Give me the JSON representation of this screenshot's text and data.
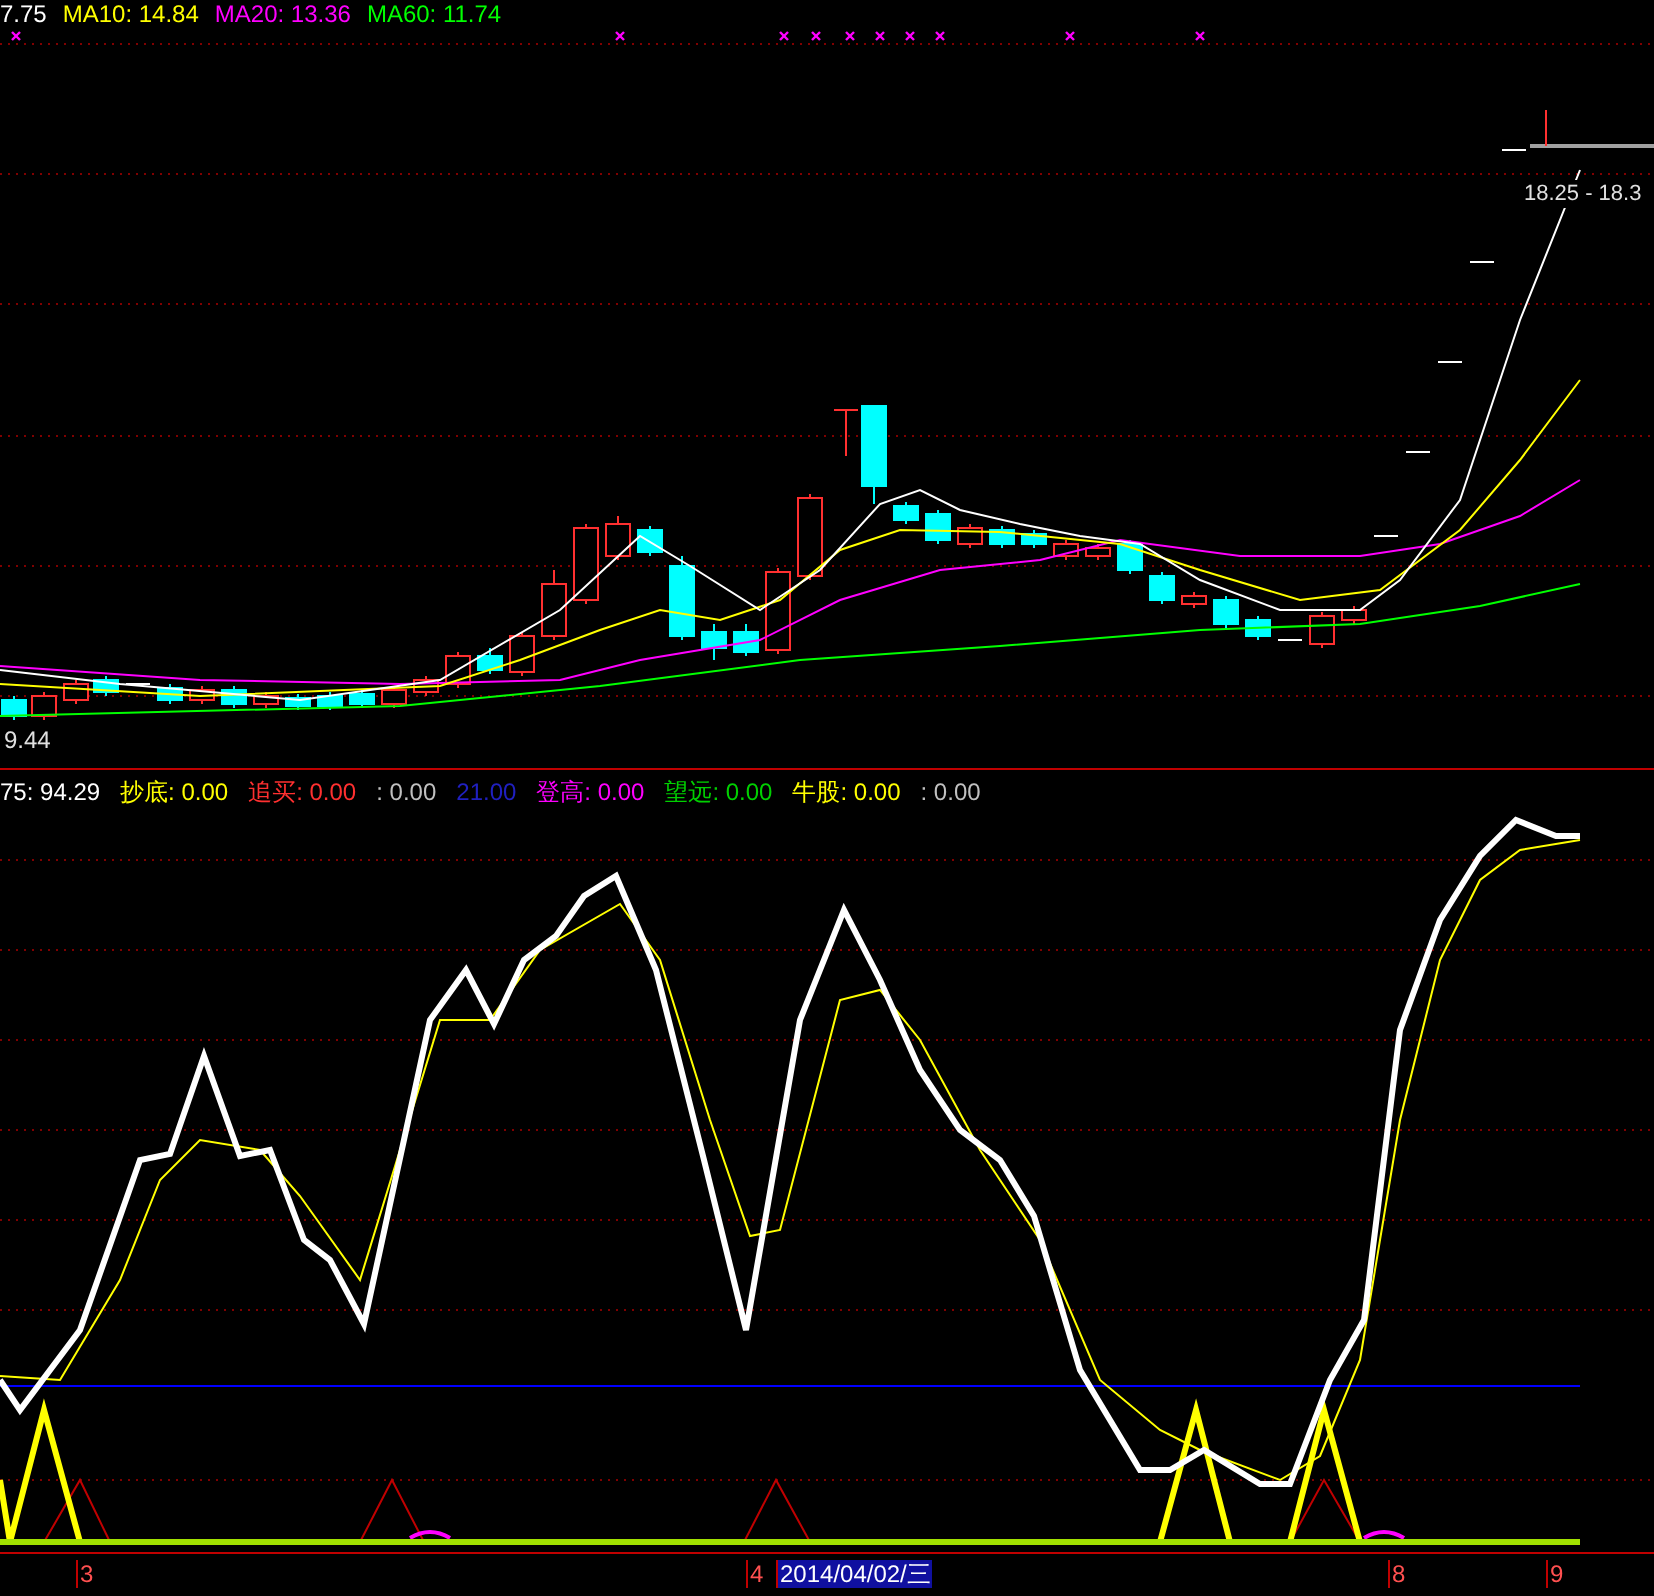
{
  "price_legend": [
    {
      "text": "7.75",
      "color": "#ffffff"
    },
    {
      "text": "MA10: 14.84",
      "color": "#ffff00"
    },
    {
      "text": "MA20: 13.36",
      "color": "#ff00ff"
    },
    {
      "text": "MA60: 11.74",
      "color": "#00ff00"
    }
  ],
  "price_range_label": "18.25 - 18.3",
  "low_price_label": "9.44",
  "indicator_legend": [
    {
      "text": "75: 94.29",
      "color": "#ffffff"
    },
    {
      "text": "抄底: 0.00",
      "color": "#ffff00"
    },
    {
      "text": "追买: 0.00",
      "color": "#ff3030"
    },
    {
      "text": ": 0.00",
      "color": "#c0c0c0"
    },
    {
      "text": "21.00",
      "color": "#2020c0"
    },
    {
      "text": "登高: 0.00",
      "color": "#ff00ff"
    },
    {
      "text": "望远: 0.00",
      "color": "#00d000"
    },
    {
      "text": "牛股: 0.00",
      "color": "#ffff00"
    },
    {
      "text": ": 0.00",
      "color": "#c0c0c0"
    }
  ],
  "x_axis": [
    {
      "text": "3",
      "selected": false
    },
    {
      "text": "4",
      "selected": false
    },
    {
      "text": "2014/04/02/三",
      "selected": true
    },
    {
      "text": "8",
      "selected": false
    },
    {
      "text": "9",
      "selected": false
    }
  ]
}
